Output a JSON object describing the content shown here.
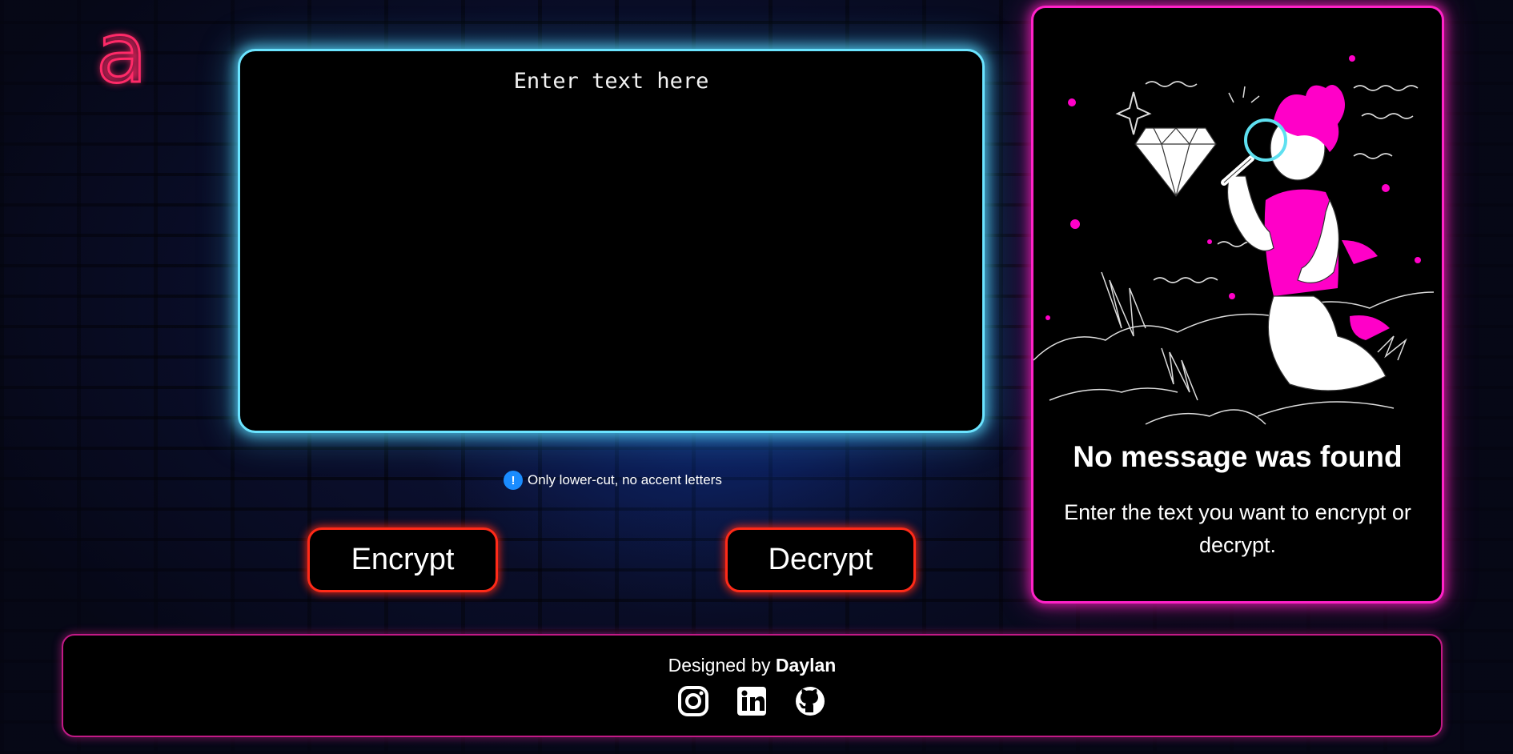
{
  "logo": {
    "glyph": "a",
    "color": "#ff2a68"
  },
  "input": {
    "placeholder": "Enter text here",
    "value": ""
  },
  "hint": {
    "icon": "info-icon",
    "badge": "!",
    "text": "Only lower-cut, no accent letters"
  },
  "buttons": {
    "encrypt": "Encrypt",
    "decrypt": "Decrypt"
  },
  "result": {
    "illustration": "person-searching-diamond-illustration",
    "title": "No message was found",
    "text": "Enter the text you want to encrypt or decrypt."
  },
  "footer": {
    "credit_prefix": "Designed by",
    "author": "Daylan",
    "socials": [
      {
        "name": "instagram-icon"
      },
      {
        "name": "linkedin-icon"
      },
      {
        "name": "github-icon"
      }
    ]
  },
  "colors": {
    "cyan_glow": "#6be4ff",
    "button_red": "#ff2a18",
    "panel_pink": "#ff22c8",
    "footer_border": "#c21a86",
    "info_blue": "#1a8cff"
  }
}
